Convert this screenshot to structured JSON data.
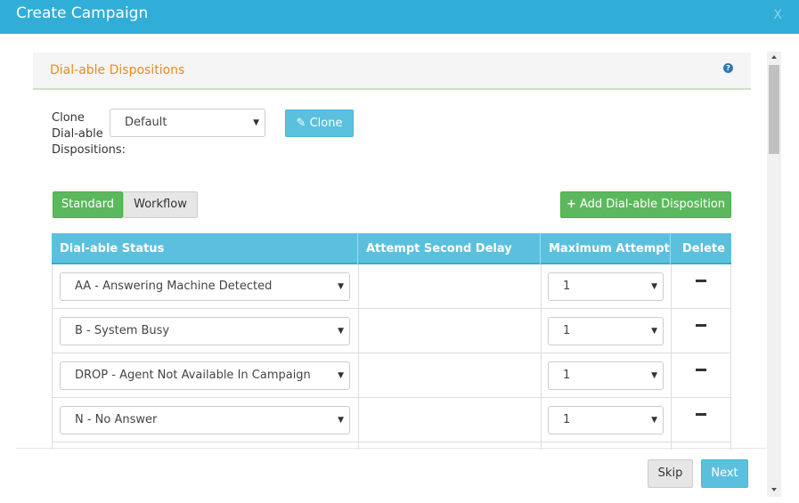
{
  "modal": {
    "title": "Create Campaign",
    "close_label": "X"
  },
  "panel": {
    "title": "Dial-able Dispositions",
    "help_glyph": "?"
  },
  "clone": {
    "label": "Clone Dial-able Dispositions:",
    "selected": "Default",
    "button_label": "Clone"
  },
  "tabs": {
    "standard": "Standard",
    "workflow": "Workflow"
  },
  "add_button_label": "Add Dial-able Disposition",
  "table": {
    "headers": {
      "status": "Dial-able Status",
      "delay": "Attempt Second Delay",
      "max": "Maximum Attempt",
      "delete": "Delete"
    },
    "rows": [
      {
        "status": "AA - Answering Machine Detected",
        "max_attempt": "1"
      },
      {
        "status": "B - System Busy",
        "max_attempt": "1"
      },
      {
        "status": "DROP - Agent Not Available In Campaign",
        "max_attempt": "1"
      },
      {
        "status": "N - No Answer",
        "max_attempt": "1"
      }
    ]
  },
  "footer": {
    "skip_label": "Skip",
    "next_label": "Next"
  },
  "colors": {
    "header_bg": "#31aed8",
    "panel_title": "#ea8c1b",
    "info_button": "#5bc0de",
    "success_button": "#5cb85c"
  }
}
